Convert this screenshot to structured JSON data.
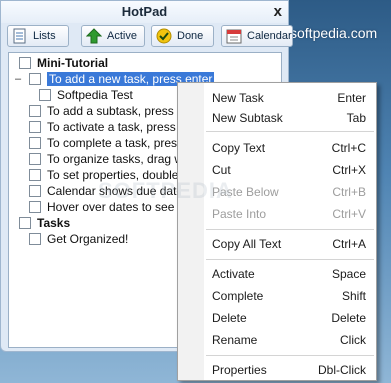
{
  "window": {
    "title": "HotPad",
    "close_symbol": "x"
  },
  "desktop_watermark": "softpedia.com",
  "toolbar": {
    "lists_label": "Lists",
    "active_label": "Active",
    "done_label": "Done",
    "calendar_label": "Calendar"
  },
  "tree": {
    "collapse_symbol": "–",
    "groups": [
      {
        "label": "Mini-Tutorial",
        "items": [
          {
            "label": "To add a new task, press enter"
          },
          {
            "label": "Softpedia Test"
          },
          {
            "label": "To add a subtask, press tab"
          },
          {
            "label": "To activate a task, press sp"
          },
          {
            "label": "To complete a task, press s"
          },
          {
            "label": "To organize tasks, drag wit"
          },
          {
            "label": "To set properties, double cl"
          },
          {
            "label": "Calendar shows due dates"
          },
          {
            "label": "Hover over dates to see du"
          }
        ]
      },
      {
        "label": "Tasks",
        "items": [
          {
            "label": "Get Organized!"
          }
        ]
      }
    ]
  },
  "context_menu": {
    "items": [
      {
        "label": "New Task",
        "shortcut": "Enter",
        "disabled": false
      },
      {
        "label": "New Subtask",
        "shortcut": "Tab",
        "disabled": false
      },
      {
        "label": "Copy Text",
        "shortcut": "Ctrl+C",
        "disabled": false
      },
      {
        "label": "Cut",
        "shortcut": "Ctrl+X",
        "disabled": false
      },
      {
        "label": "Paste Below",
        "shortcut": "Ctrl+B",
        "disabled": true
      },
      {
        "label": "Paste Into",
        "shortcut": "Ctrl+V",
        "disabled": true
      },
      {
        "label": "Copy All Text",
        "shortcut": "Ctrl+A",
        "disabled": false
      },
      {
        "label": "Activate",
        "shortcut": "Space",
        "disabled": false
      },
      {
        "label": "Complete",
        "shortcut": "Shift",
        "disabled": false
      },
      {
        "label": "Delete",
        "shortcut": "Delete",
        "disabled": false
      },
      {
        "label": "Rename",
        "shortcut": "Click",
        "disabled": false
      },
      {
        "label": "Properties",
        "shortcut": "Dbl-Click",
        "disabled": false
      }
    ]
  },
  "overlay_watermark": "SOFTPEDIA",
  "colors": {
    "selection": "#3a79d8",
    "accent_green": "#2f9a2f"
  }
}
